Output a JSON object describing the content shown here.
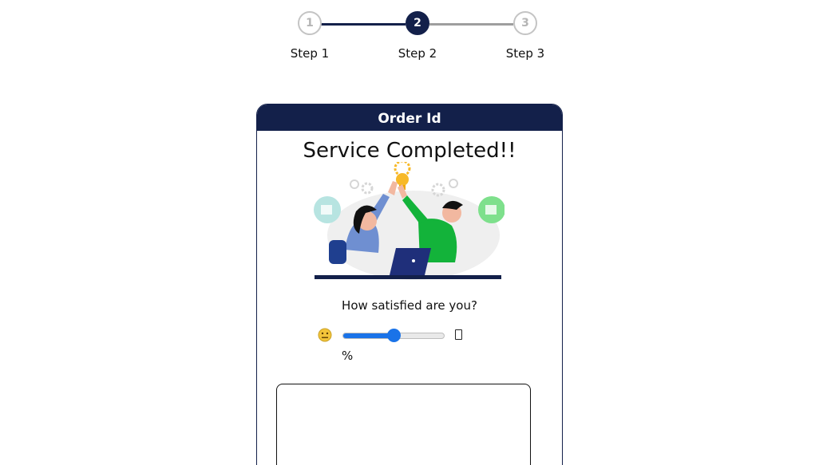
{
  "stepper": {
    "steps": [
      {
        "number": "1",
        "label": "Step 1",
        "state": "completed"
      },
      {
        "number": "2",
        "label": "Step 2",
        "state": "active"
      },
      {
        "number": "3",
        "label": "Step 3",
        "state": "pending"
      }
    ],
    "active_color": "#13204a",
    "inactive_color": "#c4c4c4"
  },
  "card": {
    "header": "Order Id",
    "title": "Service Completed!!",
    "illustration_icon": "high-five-illustration",
    "question": "How satisfied are you?",
    "slider": {
      "value_fraction": 0.5,
      "left_icon": "neutral-face-emoji",
      "right_icon": "missing-glyph-box",
      "accent": "#1a73e8"
    },
    "percent_text": "%",
    "feedback": {
      "value": ""
    }
  }
}
